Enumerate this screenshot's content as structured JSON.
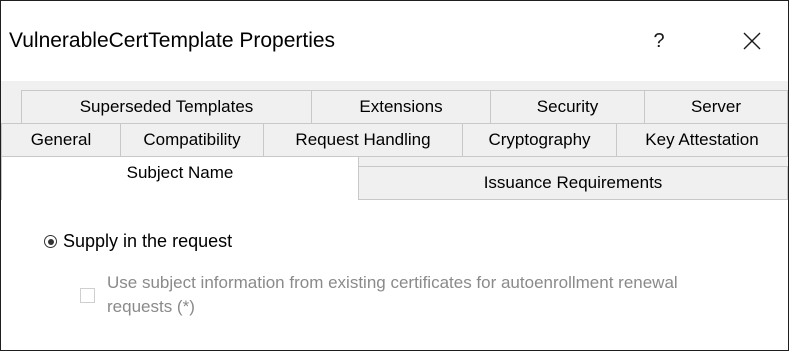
{
  "window": {
    "title": "VulnerableCertTemplate Properties",
    "help_label": "?"
  },
  "tabs": {
    "row1": [
      {
        "label": "Superseded Templates"
      },
      {
        "label": "Extensions"
      },
      {
        "label": "Security"
      },
      {
        "label": "Server"
      }
    ],
    "row2": [
      {
        "label": "General"
      },
      {
        "label": "Compatibility"
      },
      {
        "label": "Request Handling"
      },
      {
        "label": "Cryptography"
      },
      {
        "label": "Key Attestation"
      }
    ],
    "row3": [
      {
        "label": "Subject Name",
        "selected": true
      },
      {
        "label": "Issuance Requirements"
      }
    ]
  },
  "subject_name": {
    "supply_option": {
      "label": "Supply in the request",
      "checked": true
    },
    "autoenroll_option": {
      "label": "Use subject information from existing certificates for autoenrollment renewal requests (*)",
      "checked": false,
      "enabled": false
    }
  },
  "icons": {
    "close": "close-icon",
    "help": "help-icon"
  }
}
